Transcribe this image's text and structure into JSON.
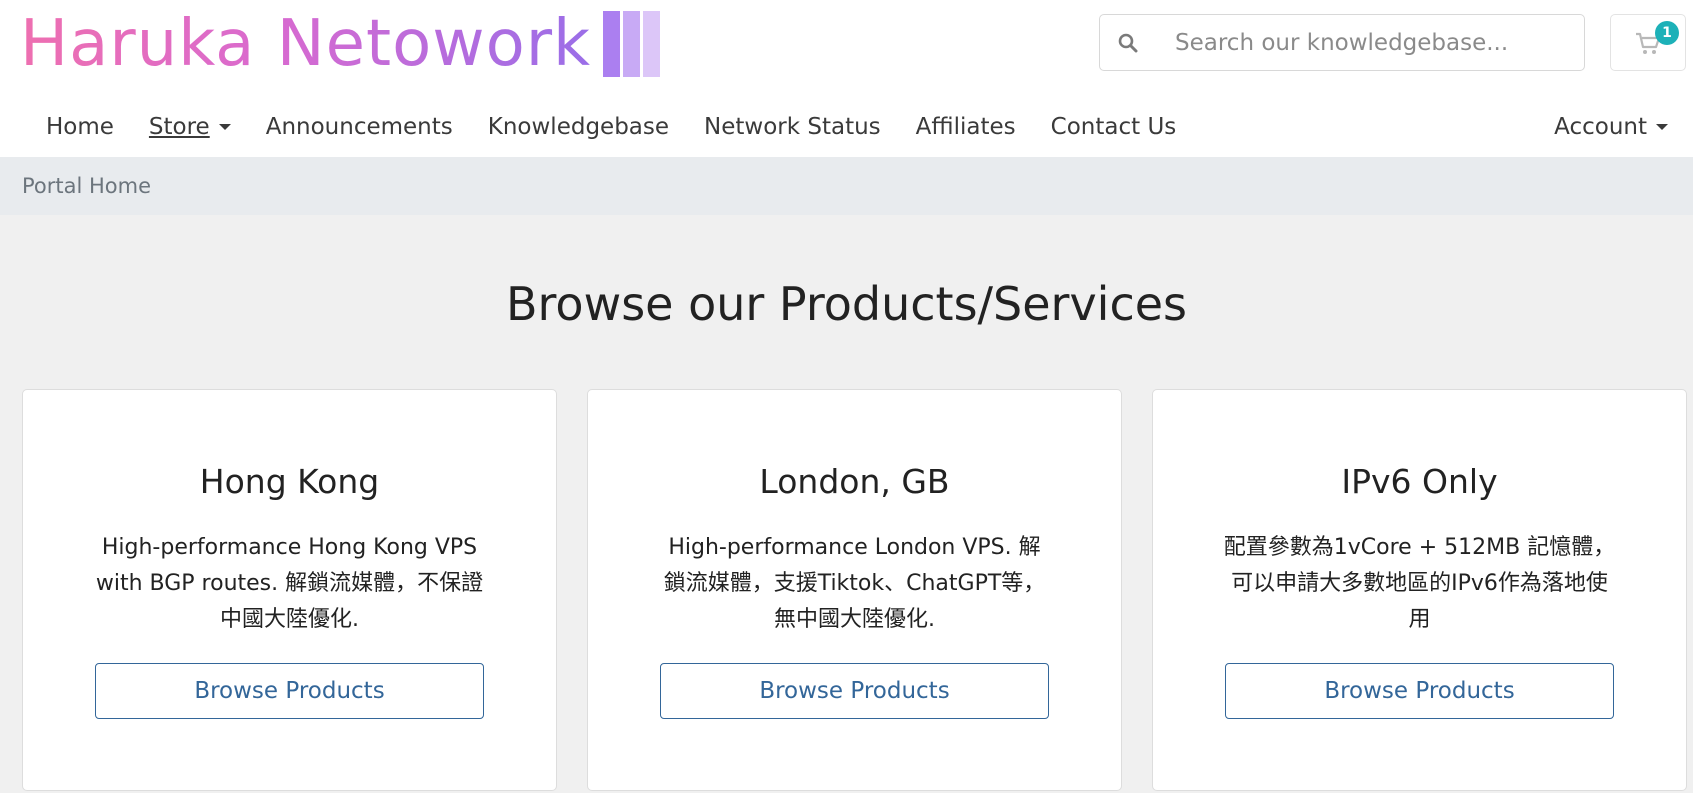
{
  "brand": {
    "name": "Haruka Netowork"
  },
  "search": {
    "placeholder": "Search our knowledgebase..."
  },
  "cart": {
    "count": "1"
  },
  "nav": {
    "items": [
      {
        "label": "Home"
      },
      {
        "label": "Store"
      },
      {
        "label": "Announcements"
      },
      {
        "label": "Knowledgebase"
      },
      {
        "label": "Network Status"
      },
      {
        "label": "Affiliates"
      },
      {
        "label": "Contact Us"
      }
    ],
    "account": "Account"
  },
  "breadcrumb": {
    "current": "Portal Home"
  },
  "main": {
    "title": "Browse our Products/Services",
    "cards": [
      {
        "title": "Hong Kong",
        "description": "High-performance Hong Kong VPS with BGP routes. 解鎖流媒體，不保證中國大陸優化.",
        "button": "Browse Products"
      },
      {
        "title": "London, GB",
        "description": "High-performance London VPS. 解鎖流媒體，支援Tiktok、ChatGPT等，無中國大陸優化.",
        "button": "Browse Products"
      },
      {
        "title": "IPv6 Only",
        "description": "配置參數為1vCore + 512MB 記憶體，可以申請大多數地區的IPv6作為落地使用",
        "button": "Browse Products"
      }
    ]
  },
  "colors": {
    "accent": "#336699",
    "badge": "#1db1b8",
    "logo_gradient_start": "#ee6fb0",
    "logo_gradient_end": "#9a6ee8"
  }
}
